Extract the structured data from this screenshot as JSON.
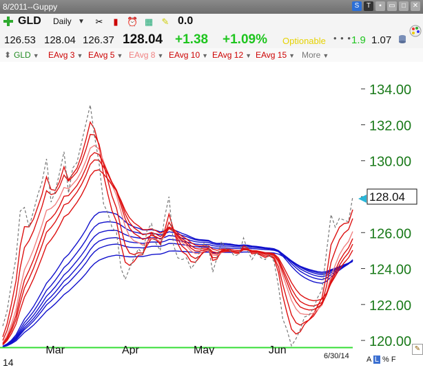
{
  "window": {
    "title": "8/2011--Guppy"
  },
  "toolbar": {
    "symbol": "GLD",
    "period": "Daily",
    "value": "0.0"
  },
  "quote": {
    "open": "126.53",
    "high": "128.04",
    "low": "126.37",
    "last": "128.04",
    "change": "+1.38",
    "change_pct": "+1.09%",
    "optionable": "Optionable",
    "dots": "• • •",
    "m1": "1.9",
    "m2": "1.07"
  },
  "legend": [
    {
      "label": "GLD",
      "color": "#228b22"
    },
    {
      "label": "EAvg 3",
      "color": "#cc0000"
    },
    {
      "label": "EAvg 5",
      "color": "#cc0000"
    },
    {
      "label": "EAvg 8",
      "color": "#f08080"
    },
    {
      "label": "EAvg 10",
      "color": "#cc0000"
    },
    {
      "label": "EAvg 12",
      "color": "#cc0000"
    },
    {
      "label": "EAvg 15",
      "color": "#cc0000"
    },
    {
      "label": "More",
      "color": "#777777"
    }
  ],
  "footer": {
    "left": "14",
    "date": "6/30/14",
    "mode_a": "A",
    "mode_l": "L",
    "mode_pct": "%",
    "mode_f": "F"
  },
  "chart_data": {
    "type": "line",
    "title": "",
    "xlabel": "",
    "ylabel": "",
    "ylim": [
      119.2,
      135.5
    ],
    "x_ticks": [
      "Mar",
      "Apr",
      "May",
      "Jun"
    ],
    "y_ticks": [
      "120.00",
      "122.00",
      "124.00",
      "126.00",
      "128.00",
      "130.00",
      "132.00",
      "134.00"
    ],
    "y_tick_values": [
      120,
      122,
      124,
      126,
      128,
      130,
      132,
      134
    ],
    "last_price_label": "128.04",
    "last_price": 128.04,
    "reference_line": 119.6,
    "colors": {
      "price": "#777777",
      "short_emas": "#dd1111",
      "long_emas": "#1111cc",
      "reference": "#33dd33",
      "axis_text": "#1a7a1a"
    },
    "price": [
      [
        0,
        120.8
      ],
      [
        0.012,
        121.6
      ],
      [
        0.025,
        123.2
      ],
      [
        0.038,
        124.6
      ],
      [
        0.05,
        127.2
      ],
      [
        0.062,
        127.4
      ],
      [
        0.075,
        126.3
      ],
      [
        0.088,
        127.2
      ],
      [
        0.1,
        128.1
      ],
      [
        0.112,
        128.8
      ],
      [
        0.125,
        130.1
      ],
      [
        0.138,
        127.7
      ],
      [
        0.15,
        128.3
      ],
      [
        0.162,
        129.3
      ],
      [
        0.175,
        130.5
      ],
      [
        0.188,
        128.2
      ],
      [
        0.2,
        129.6
      ],
      [
        0.212,
        129.9
      ],
      [
        0.225,
        131.0
      ],
      [
        0.238,
        132.1
      ],
      [
        0.25,
        133.1
      ],
      [
        0.262,
        131.4
      ],
      [
        0.275,
        129.9
      ],
      [
        0.288,
        127.6
      ],
      [
        0.3,
        127.1
      ],
      [
        0.312,
        126.3
      ],
      [
        0.325,
        126.0
      ],
      [
        0.338,
        124.0
      ],
      [
        0.35,
        123.4
      ],
      [
        0.362,
        124.0
      ],
      [
        0.375,
        124.6
      ],
      [
        0.388,
        125.1
      ],
      [
        0.4,
        124.8
      ],
      [
        0.412,
        126.1
      ],
      [
        0.425,
        126.5
      ],
      [
        0.438,
        125.4
      ],
      [
        0.45,
        125.0
      ],
      [
        0.462,
        126.8
      ],
      [
        0.475,
        128.0
      ],
      [
        0.488,
        125.3
      ],
      [
        0.5,
        124.6
      ],
      [
        0.512,
        124.5
      ],
      [
        0.525,
        124.6
      ],
      [
        0.538,
        124.0
      ],
      [
        0.55,
        124.3
      ],
      [
        0.562,
        124.9
      ],
      [
        0.575,
        125.4
      ],
      [
        0.588,
        125.2
      ],
      [
        0.6,
        123.8
      ],
      [
        0.612,
        124.6
      ],
      [
        0.625,
        125.5
      ],
      [
        0.638,
        125.1
      ],
      [
        0.65,
        125.0
      ],
      [
        0.662,
        124.7
      ],
      [
        0.675,
        124.8
      ],
      [
        0.688,
        125.7
      ],
      [
        0.7,
        125.0
      ],
      [
        0.712,
        124.5
      ],
      [
        0.725,
        124.9
      ],
      [
        0.738,
        124.6
      ],
      [
        0.75,
        124.5
      ],
      [
        0.762,
        124.8
      ],
      [
        0.775,
        124.4
      ],
      [
        0.788,
        123.0
      ],
      [
        0.8,
        121.2
      ],
      [
        0.812,
        120.6
      ],
      [
        0.825,
        119.7
      ],
      [
        0.838,
        120.1
      ],
      [
        0.85,
        120.6
      ],
      [
        0.862,
        121.3
      ],
      [
        0.875,
        121.4
      ],
      [
        0.888,
        121.8
      ],
      [
        0.9,
        122.4
      ],
      [
        0.912,
        122.8
      ],
      [
        0.925,
        124.9
      ],
      [
        0.938,
        127.0
      ],
      [
        0.95,
        126.3
      ],
      [
        0.962,
        126.8
      ],
      [
        0.975,
        126.7
      ],
      [
        0.988,
        126.6
      ],
      [
        1,
        128.0
      ]
    ],
    "ema_spans": [
      3,
      5,
      8,
      10,
      12,
      15,
      30,
      35,
      40,
      45,
      50,
      60
    ]
  }
}
